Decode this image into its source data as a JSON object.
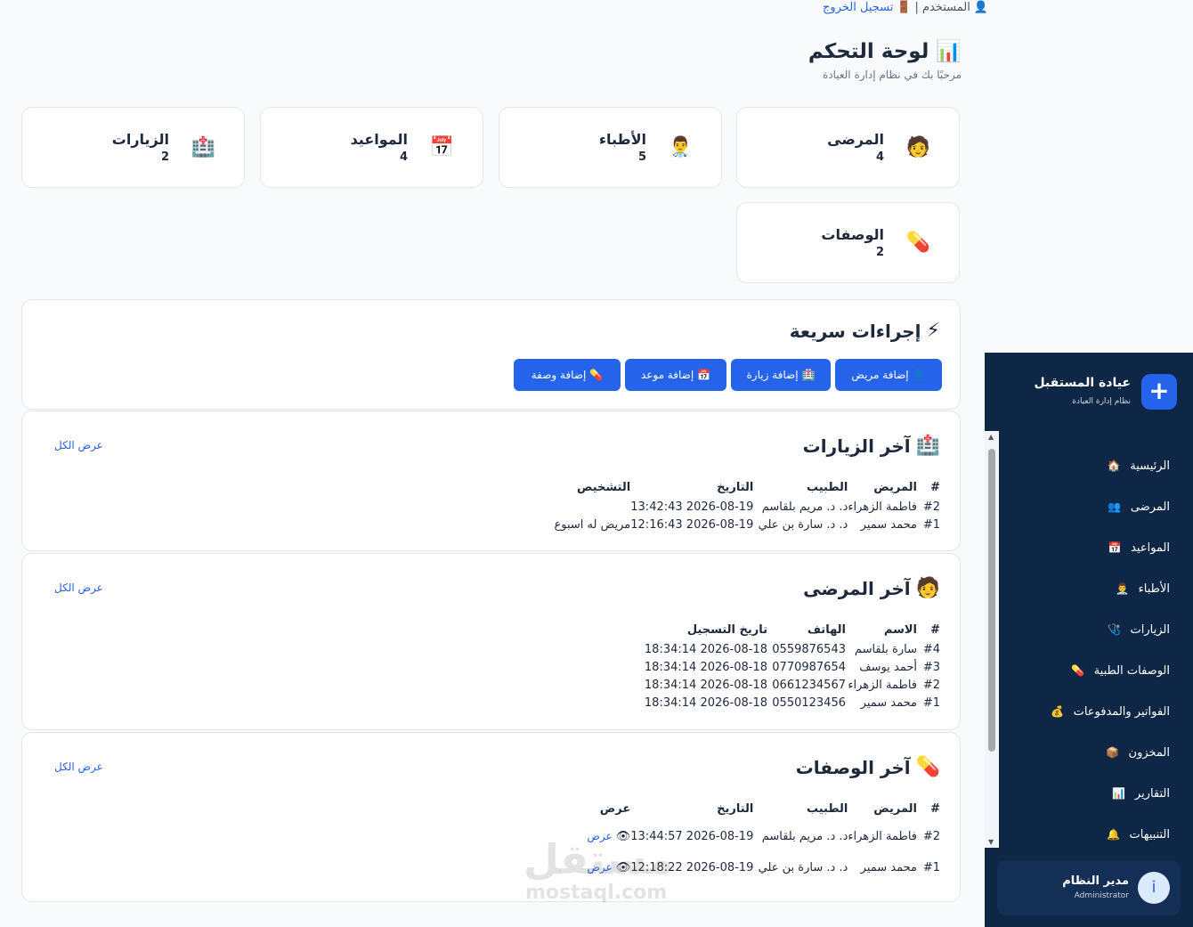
{
  "topbar": {
    "user": "المستخدم",
    "separator": "|",
    "logout": "تسجيل الخروج"
  },
  "header": {
    "title": "لوحة التحكم",
    "subtitle": "مرحبًا بك في نظام إدارة العيادة"
  },
  "stats": [
    {
      "label": "المرضى",
      "value": "4",
      "icon": "🧑"
    },
    {
      "label": "الأطباء",
      "value": "5",
      "icon": "👨‍⚕️"
    },
    {
      "label": "المواعيد",
      "value": "4",
      "icon": "📅"
    },
    {
      "label": "الزيارات",
      "value": "2",
      "icon": "🏥"
    },
    {
      "label": "الوصفات",
      "value": "2",
      "icon": "💊"
    }
  ],
  "quick": {
    "title": "إجراءات سريعة",
    "icon": "⚡",
    "buttons": [
      {
        "label": "إضافة مريض",
        "icon": "👤"
      },
      {
        "label": "إضافة زيارة",
        "icon": "🏥"
      },
      {
        "label": "إضافة موعد",
        "icon": "📅"
      },
      {
        "label": "إضافة وصفة",
        "icon": "💊"
      }
    ]
  },
  "visits": {
    "title": "آخر الزيارات",
    "icon": "🏥",
    "view_all": "عرض الكل",
    "headers": [
      "#",
      "المريض",
      "الطبيب",
      "التاريخ",
      "التشخيص"
    ],
    "rows": [
      [
        "#2",
        "فاطمة الزهراء",
        "د. د. مريم بلقاسم",
        "2026-08-19 13:42:43",
        ""
      ],
      [
        "#1",
        "محمد سمير",
        "د. د. سارة بن علي",
        "2026-08-19 12:16:43",
        "مريض له اسبوع"
      ]
    ]
  },
  "patients": {
    "title": "آخر المرضى",
    "icon": "🧑",
    "view_all": "عرض الكل",
    "headers": [
      "#",
      "الاسم",
      "الهاتف",
      "تاريخ التسجيل"
    ],
    "rows": [
      [
        "#4",
        "سارة بلقاسم",
        "0559876543",
        "2026-08-18 18:34:14"
      ],
      [
        "#3",
        "أحمد يوسف",
        "0770987654",
        "2026-08-18 18:34:14"
      ],
      [
        "#2",
        "فاطمة الزهراء",
        "0661234567",
        "2026-08-18 18:34:14"
      ],
      [
        "#1",
        "محمد سمير",
        "0550123456",
        "2026-08-18 18:34:14"
      ]
    ]
  },
  "prescriptions": {
    "title": "آخر الوصفات",
    "icon": "💊",
    "view_all": "عرض الكل",
    "headers": [
      "#",
      "المريض",
      "الطبيب",
      "التاريخ",
      "عرض"
    ],
    "view_label": "عرض",
    "rows": [
      [
        "#2",
        "فاطمة الزهراء",
        "د. د. مريم بلقاسم",
        "2026-08-19 13:44:57"
      ],
      [
        "#1",
        "محمد سمير",
        "د. د. سارة بن علي",
        "2026-08-19 12:18:22"
      ]
    ]
  },
  "sidebar": {
    "brand": "عيادة المستقبل",
    "brand_sub": "نظام إدارة العيادة",
    "items": [
      {
        "label": "الرئيسية",
        "icon": "🏠"
      },
      {
        "label": "المرضى",
        "icon": "👥"
      },
      {
        "label": "المواعيد",
        "icon": "📅"
      },
      {
        "label": "الأطباء",
        "icon": "👨‍⚕️"
      },
      {
        "label": "الزيارات",
        "icon": "🩺"
      },
      {
        "label": "الوصفات الطبية",
        "icon": "💊"
      },
      {
        "label": "الفواتير والمدفوعات",
        "icon": "💰"
      },
      {
        "label": "المخزون",
        "icon": "📦"
      },
      {
        "label": "التقارير",
        "icon": "📊"
      },
      {
        "label": "التنبيهات",
        "icon": "🔔"
      }
    ],
    "user_name": "مدير النظام",
    "user_role": "Administrator",
    "avatar": "i"
  },
  "watermark": {
    "ar": "مستقل",
    "en": "mostaql.com"
  }
}
